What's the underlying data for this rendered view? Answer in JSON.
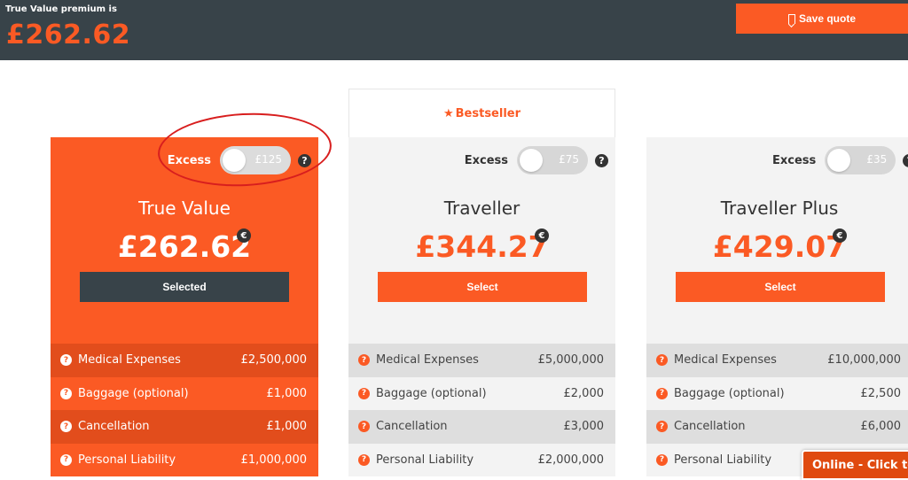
{
  "header": {
    "premium_label": "True Value premium is",
    "premium_value": "£262.62",
    "save_label": "Save quote"
  },
  "bestseller": {
    "label": "Bestseller"
  },
  "plans": [
    {
      "excess_label": "Excess",
      "excess_value": "£125",
      "name": "True Value",
      "price": "£262.62",
      "button": "Selected",
      "benefits": [
        {
          "name": "Medical Expenses",
          "value": "£2,500,000"
        },
        {
          "name": "Baggage (optional)",
          "value": "£1,000"
        },
        {
          "name": "Cancellation",
          "value": "£1,000"
        },
        {
          "name": "Personal Liability",
          "value": "£1,000,000"
        }
      ]
    },
    {
      "excess_label": "Excess",
      "excess_value": "£75",
      "name": "Traveller",
      "price": "£344.27",
      "button": "Select",
      "benefits": [
        {
          "name": "Medical Expenses",
          "value": "£5,000,000"
        },
        {
          "name": "Baggage (optional)",
          "value": "£2,000"
        },
        {
          "name": "Cancellation",
          "value": "£3,000"
        },
        {
          "name": "Personal Liability",
          "value": "£2,000,000"
        }
      ]
    },
    {
      "excess_label": "Excess",
      "excess_value": "£35",
      "name": "Traveller Plus",
      "price": "£429.07",
      "button": "Select",
      "benefits": [
        {
          "name": "Medical Expenses",
          "value": "£10,000,000"
        },
        {
          "name": "Baggage (optional)",
          "value": "£2,500"
        },
        {
          "name": "Cancellation",
          "value": "£6,000"
        },
        {
          "name": "Personal Liability",
          "value": ""
        }
      ]
    }
  ],
  "chat": {
    "label": "Online - Click to g"
  },
  "colors": {
    "brand": "#fb5a24",
    "dark": "#384349",
    "highlight": "#d81e1e"
  }
}
